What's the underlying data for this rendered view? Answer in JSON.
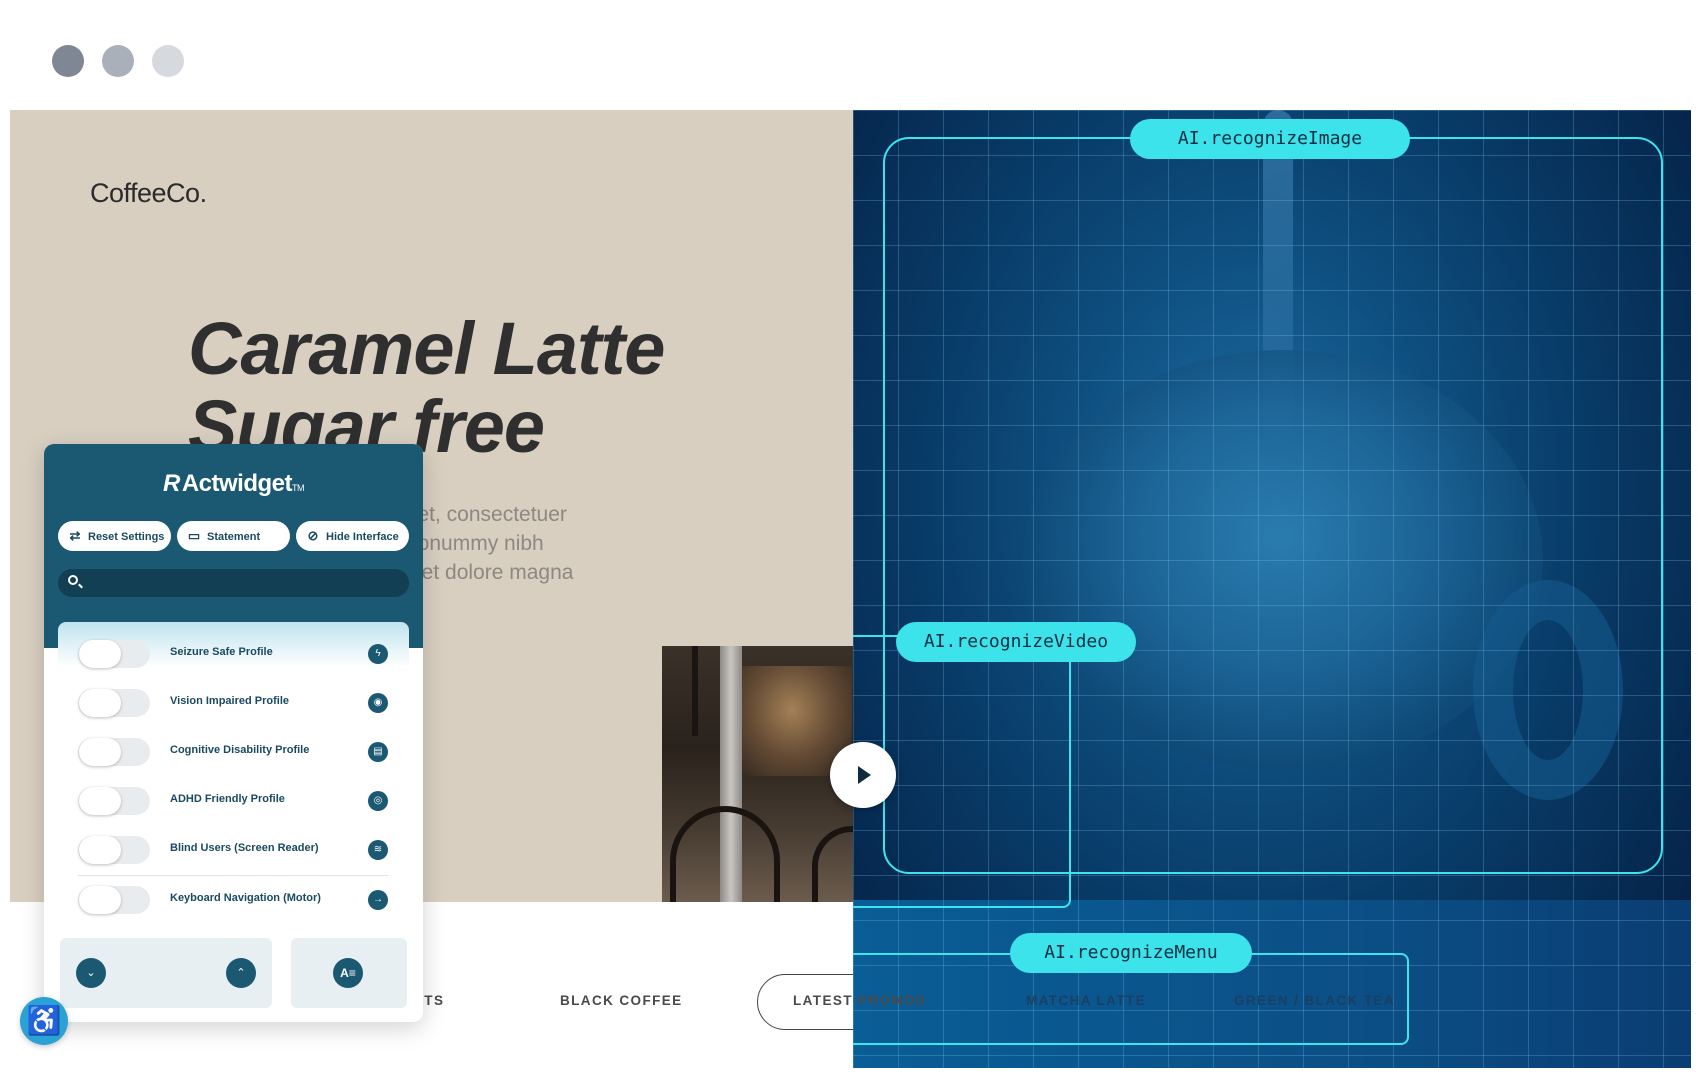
{
  "window": {
    "controls": [
      "close",
      "minimize",
      "maximize"
    ]
  },
  "site": {
    "logo": "CoffeeCo.",
    "headline": [
      "Caramel Latte",
      "Sugar free"
    ],
    "paragraph": [
      "met, consectetuer",
      "nonummy nibh",
      "reet dolore magna"
    ],
    "nav": [
      "UCTS",
      "BLACK COFFEE",
      "LATEST PROMOS",
      "MATCHA LATTE",
      "GREEN / BLACK TEA"
    ]
  },
  "ai": {
    "image_tag": "AI.recognizeImage",
    "video_tag": "AI.recognizeVideo",
    "menu_tag": "AI.recognizeMenu"
  },
  "widget": {
    "brand": "Actwidget",
    "brand_tm": "TM",
    "buttons": {
      "reset": "Reset Settings",
      "statement": "Statement",
      "hide": "Hide Interface"
    },
    "search_placeholder": "",
    "profiles": [
      {
        "label": "Seizure Safe Profile",
        "icon": "bolt-icon",
        "glyph": "ϟ"
      },
      {
        "label": "Vision Impaired Profile",
        "icon": "eye-icon",
        "glyph": "◉"
      },
      {
        "label": "Cognitive Disability Profile",
        "icon": "brain-icon",
        "glyph": "▤"
      },
      {
        "label": "ADHD Friendly Profile",
        "icon": "target-icon",
        "glyph": "◎"
      },
      {
        "label": "Blind Users (Screen Reader)",
        "icon": "soundwave-icon",
        "glyph": "≋"
      },
      {
        "label": "Keyboard Navigation (Motor)",
        "icon": "arrow-right-icon",
        "glyph": "→"
      }
    ],
    "footer": {
      "down": "⌄",
      "up": "⌃",
      "font": "A≡"
    }
  },
  "accessibility_button": {
    "glyph": "♿"
  },
  "colors": {
    "hero_bg": "#d8cfc1",
    "widget_primary": "#1b5872",
    "ai_accent": "#3de3ea",
    "a11y_button": "#2aa2d5"
  }
}
